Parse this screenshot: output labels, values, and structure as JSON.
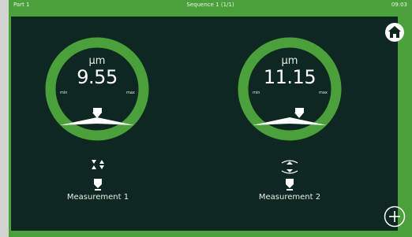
{
  "topbar": {
    "left": "Part 1",
    "center": "Sequence 1 (1/1)",
    "right": "09:03"
  },
  "gauges": [
    {
      "unit": "µm",
      "value": "9.55",
      "min_label": "min",
      "max_label": "max",
      "label": "Measurement 1",
      "marker_position": 0.45
    },
    {
      "unit": "µm",
      "value": "11.15",
      "min_label": "min",
      "max_label": "max",
      "label": "Measurement 2",
      "marker_position": 0.7
    }
  ],
  "colors": {
    "ring": "#4aa03a",
    "background": "#0f2721",
    "frame": "#4aa03a"
  },
  "icons": {
    "home": "home-icon",
    "add": "plus-circle-icon"
  }
}
